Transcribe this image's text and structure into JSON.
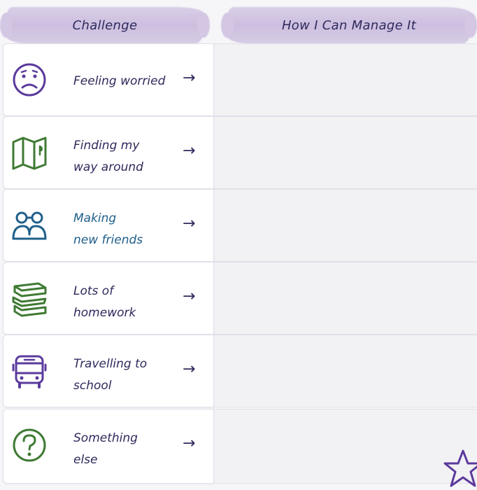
{
  "headers": {
    "challenge": "Challenge",
    "manage": "How I Can Manage It"
  },
  "rows": [
    {
      "line1": "Feeling worried",
      "line2": "",
      "icon": "sad-face-icon",
      "color": "#5b3a9c"
    },
    {
      "line1": "Finding my",
      "line2": "way around",
      "icon": "map-icon",
      "color": "#3f7a34"
    },
    {
      "line1": "Making",
      "line2": "new friends",
      "icon": "friends-icon",
      "color": "#1f5f8b"
    },
    {
      "line1": "Lots of",
      "line2": "homework",
      "icon": "books-icon",
      "color": "#3f7a34"
    },
    {
      "line1": "Travelling to",
      "line2": "school",
      "icon": "bus-icon",
      "color": "#5b3a9c"
    },
    {
      "line1": "Something",
      "line2": "else",
      "icon": "question-icon",
      "color": "#3f7a34"
    }
  ],
  "arrow": "→"
}
